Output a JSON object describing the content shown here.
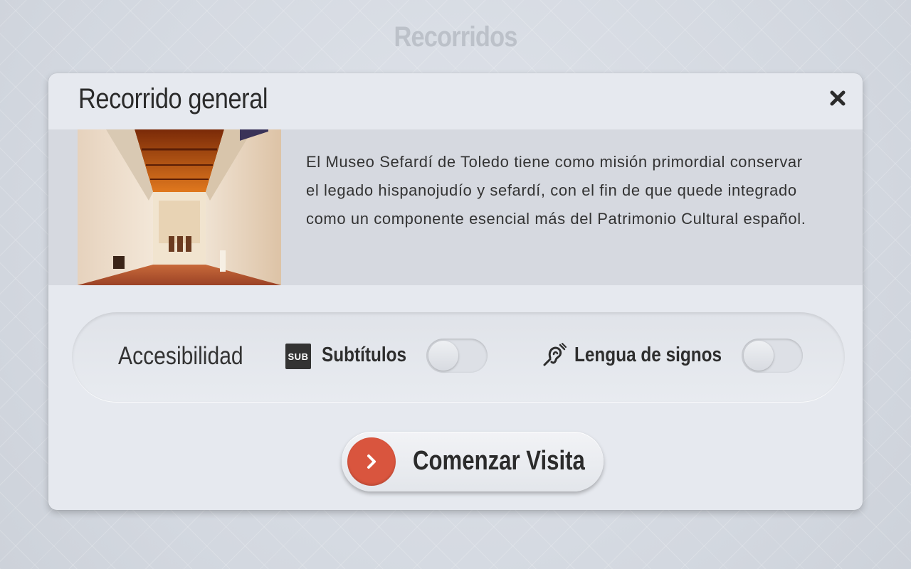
{
  "page": {
    "title": "Recorridos"
  },
  "modal": {
    "title": "Recorrido general",
    "close_icon": "close-icon",
    "image_alt": "Interior de la Sinagoga del Tránsito",
    "description": "El Museo Sefardí de Toledo tiene como misión primordial conservar el legado hispanojudío y sefardí, con el fin de que quede integrado como un componente esencial más del Patrimonio Cultural español."
  },
  "accessibility": {
    "label": "Accesibilidad",
    "subtitles": {
      "icon_text": "SUB",
      "icon": "subtitles-icon",
      "label": "Subtítulos",
      "enabled": false
    },
    "sign_language": {
      "icon": "hearing-assist-icon",
      "label": "Lengua de signos",
      "enabled": false
    }
  },
  "start_button": {
    "label": "Comenzar Visita",
    "icon": "chevron-right-icon",
    "accent": "#d9553e"
  }
}
